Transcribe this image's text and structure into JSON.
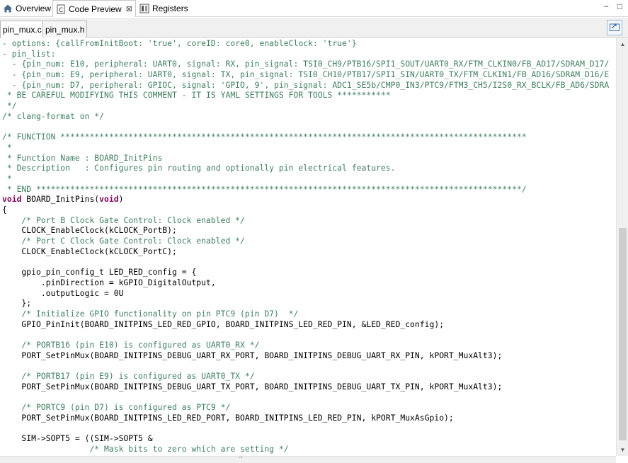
{
  "view_tabs": [
    {
      "label": "Overview",
      "icon": "home-icon"
    },
    {
      "label": "Code Preview",
      "icon": "code-preview-icon",
      "close": "⊠"
    },
    {
      "label": "Registers",
      "icon": "registers-icon"
    }
  ],
  "window_controls": {
    "minimize": "−",
    "maximize": "□"
  },
  "file_tabs": [
    {
      "label": "pin_mux.c",
      "active": true
    },
    {
      "label": "pin_mux.h",
      "active": false
    }
  ],
  "colors": {
    "comment": "#3f7f5f",
    "keyword": "#7f0055",
    "text": "#000000"
  },
  "code_lines": [
    {
      "text": "- options: {callFromInitBoot: 'true', coreID: core0, enableClock: 'true'}",
      "type": "cm"
    },
    {
      "text": "- pin_list:",
      "type": "cm"
    },
    {
      "text": "  - {pin_num: E10, peripheral: UART0, signal: RX, pin_signal: TSI0_CH9/PTB16/SPI1_SOUT/UART0_RX/FTM_CLKIN0/FB_AD17/SDRAM_D17/",
      "type": "cm"
    },
    {
      "text": "  - {pin_num: E9, peripheral: UART0, signal: TX, pin_signal: TSI0_CH10/PTB17/SPI1_SIN/UART0_TX/FTM_CLKIN1/FB_AD16/SDRAM_D16/E",
      "type": "cm"
    },
    {
      "text": "  - {pin_num: D7, peripheral: GPIOC, signal: 'GPIO, 9', pin_signal: ADC1_SE5b/CMP0_IN3/PTC9/FTM3_CH5/I2S0_RX_BCLK/FB_AD6/SDRA",
      "type": "cm"
    },
    {
      "text": " * BE CAREFUL MODIFYING THIS COMMENT - IT IS YAML SETTINGS FOR TOOLS ***********",
      "type": "cm"
    },
    {
      "text": " */",
      "type": "cm"
    },
    {
      "text": "/* clang-format on */",
      "type": "cm"
    },
    {
      "text": "",
      "type": "plain"
    },
    {
      "text": "/* FUNCTION ************************************************************************************************",
      "type": "cm"
    },
    {
      "text": " *",
      "type": "cm"
    },
    {
      "text": " * Function Name : BOARD_InitPins",
      "type": "cm"
    },
    {
      "text": " * Description   : Configures pin routing and optionally pin electrical features.",
      "type": "cm"
    },
    {
      "text": " *",
      "type": "cm"
    },
    {
      "text": " * END ****************************************************************************************************/",
      "type": "cm"
    },
    {
      "text": "void BOARD_InitPins(void)",
      "type": "kw"
    },
    {
      "text": "{",
      "type": "plain"
    },
    {
      "text": "    /* Port B Clock Gate Control: Clock enabled */",
      "type": "cm"
    },
    {
      "text": "    CLOCK_EnableClock(kCLOCK_PortB);",
      "type": "plain"
    },
    {
      "text": "    /* Port C Clock Gate Control: Clock enabled */",
      "type": "cm"
    },
    {
      "text": "    CLOCK_EnableClock(kCLOCK_PortC);",
      "type": "plain"
    },
    {
      "text": "",
      "type": "plain"
    },
    {
      "text": "    gpio_pin_config_t LED_RED_config = {",
      "type": "plain"
    },
    {
      "text": "        .pinDirection = kGPIO_DigitalOutput,",
      "type": "plain"
    },
    {
      "text": "        .outputLogic = 0U",
      "type": "plain"
    },
    {
      "text": "    };",
      "type": "plain"
    },
    {
      "text": "    /* Initialize GPIO functionality on pin PTC9 (pin D7)  */",
      "type": "cm"
    },
    {
      "text": "    GPIO_PinInit(BOARD_INITPINS_LED_RED_GPIO, BOARD_INITPINS_LED_RED_PIN, &LED_RED_config);",
      "type": "plain"
    },
    {
      "text": "",
      "type": "plain"
    },
    {
      "text": "    /* PORTB16 (pin E10) is configured as UART0_RX */",
      "type": "cm"
    },
    {
      "text": "    PORT_SetPinMux(BOARD_INITPINS_DEBUG_UART_RX_PORT, BOARD_INITPINS_DEBUG_UART_RX_PIN, kPORT_MuxAlt3);",
      "type": "plain"
    },
    {
      "text": "",
      "type": "plain"
    },
    {
      "text": "    /* PORTB17 (pin E9) is configured as UART0_TX */",
      "type": "cm"
    },
    {
      "text": "    PORT_SetPinMux(BOARD_INITPINS_DEBUG_UART_TX_PORT, BOARD_INITPINS_DEBUG_UART_TX_PIN, kPORT_MuxAlt3);",
      "type": "plain"
    },
    {
      "text": "",
      "type": "plain"
    },
    {
      "text": "    /* PORTC9 (pin D7) is configured as PTC9 */",
      "type": "cm"
    },
    {
      "text": "    PORT_SetPinMux(BOARD_INITPINS_LED_RED_PORT, BOARD_INITPINS_LED_RED_PIN, kPORT_MuxAsGpio);",
      "type": "plain"
    },
    {
      "text": "",
      "type": "plain"
    },
    {
      "text": "    SIM->SOPT5 = ((SIM->SOPT5 &",
      "type": "plain"
    },
    {
      "text": "                  /* Mask bits to zero which are setting */",
      "type": "cm"
    }
  ],
  "hscroll_grip": "'''"
}
